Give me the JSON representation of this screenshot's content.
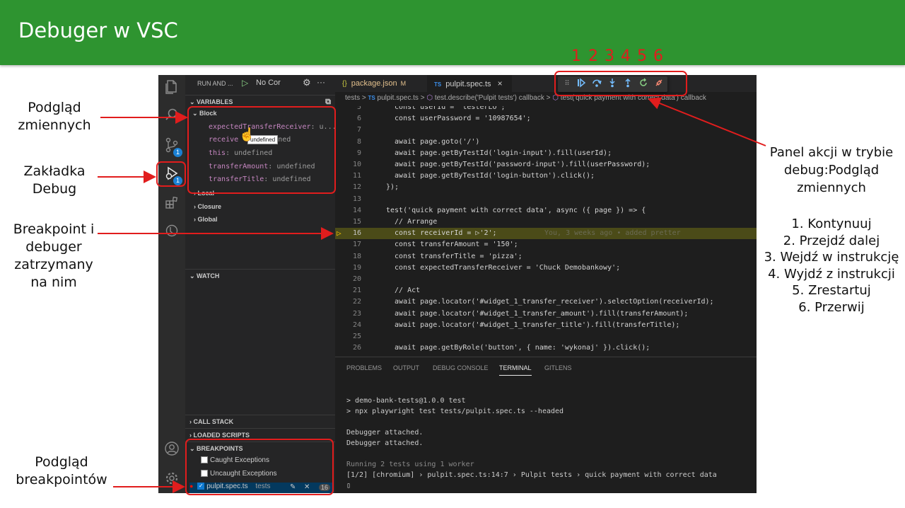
{
  "slide": {
    "title": "Debuger w VSC",
    "left_labels": {
      "variables_preview": [
        "Podgląd",
        "zmiennych"
      ],
      "debug_tab": [
        "Zakładka",
        "Debug"
      ],
      "breakpoint": [
        "Breakpoint i",
        "debuger",
        "zatrzymany",
        "na nim"
      ],
      "breakpoints_preview": [
        "Podgląd",
        "breakpointów"
      ]
    },
    "right_panel": {
      "heading": [
        "Panel akcji w trybie",
        "debug:Podgląd",
        "zmiennych"
      ],
      "actions": [
        "1. Kontynuuj",
        "2. Przejdź dalej",
        "3. Wejdź w instrukcję",
        "4. Wyjdź z instrukcji",
        "5. Zrestartuj",
        "6. Przerwij"
      ]
    },
    "toolbar_numbers": [
      "1",
      "2",
      "3",
      "4",
      "5",
      "6"
    ]
  },
  "colors": {
    "header_green": "#2e9430",
    "annotation_red": "#e11d1d",
    "vscode_bg": "#1e1e1e",
    "sidebar_bg": "#252526",
    "debug_blue": "#75beff",
    "continue_blue": "#75beff",
    "restart_green": "#89d185",
    "disconnect_red": "#f48771"
  },
  "vscode": {
    "activity_icons": [
      "files-icon",
      "search-icon",
      "source-control-icon",
      "run-debug-icon",
      "extensions-icon",
      "testing-icon",
      "account-icon",
      "settings-gear-icon"
    ],
    "badges": {
      "source_control": "1",
      "run_debug": "1"
    },
    "sidebar": {
      "run_label": "RUN AND ...",
      "config": "No Cor",
      "variables_header": "VARIABLES",
      "block_label": "Block",
      "variables": [
        {
          "name": "expectedTransferReceiver",
          "value": ": u..."
        },
        {
          "name": "receive",
          "value": "efined"
        },
        {
          "name": "this",
          "value": ": undefined"
        },
        {
          "name": "transferAmount",
          "value": ": undefined"
        },
        {
          "name": "transferTitle",
          "value": ": undefined"
        }
      ],
      "tooltip": "undefined",
      "scopes": [
        "Local",
        "Closure",
        "Global"
      ],
      "watch_header": "WATCH",
      "call_stack_header": "CALL STACK",
      "loaded_scripts_header": "LOADED SCRIPTS",
      "breakpoints_header": "BREAKPOINTS",
      "breakpoints": [
        {
          "label": "Caught Exceptions"
        },
        {
          "label": "Uncaught Exceptions"
        },
        {
          "label": "pulpit.spec.ts",
          "folder": "tests",
          "line": "16"
        }
      ]
    },
    "tabs": [
      {
        "icon": "{}",
        "label": "package.json",
        "status": "M"
      },
      {
        "icon": "TS",
        "label": "pulpit.spec.ts",
        "close": "×"
      }
    ],
    "breadcrumbs": {
      "folder": "tests",
      "sep": ">",
      "ts": "TS",
      "file": "pulpit.spec.ts",
      "describe": "test.describe('Pulpit tests') callback",
      "test": "test('quick payment with correct data') callback"
    },
    "code_lines": [
      {
        "n": "5",
        "t": "  const userId = 'testerLO';"
      },
      {
        "n": "6",
        "t": "  const userPassword = '10987654';"
      },
      {
        "n": "7",
        "t": ""
      },
      {
        "n": "8",
        "t": "  await page.goto('/')"
      },
      {
        "n": "9",
        "t": "  await page.getByTestId('login-input').fill(userId);"
      },
      {
        "n": "10",
        "t": "  await page.getByTestId('password-input').fill(userPassword);"
      },
      {
        "n": "11",
        "t": "  await page.getByTestId('login-button').click();"
      },
      {
        "n": "12",
        "t": "});"
      },
      {
        "n": "13",
        "t": ""
      },
      {
        "n": "14",
        "t": "test('quick payment with correct data', async ({ page }) => {"
      },
      {
        "n": "15",
        "t": "  // Arrange"
      },
      {
        "n": "16",
        "t": "  const receiverId = ▷'2';"
      },
      {
        "n": "17",
        "t": "  const transferAmount = '150';"
      },
      {
        "n": "18",
        "t": "  const transferTitle = 'pizza';"
      },
      {
        "n": "19",
        "t": "  const expectedTransferReceiver = 'Chuck Demobankowy';"
      },
      {
        "n": "20",
        "t": ""
      },
      {
        "n": "21",
        "t": "  // Act"
      },
      {
        "n": "22",
        "t": "  await page.locator('#widget_1_transfer_receiver').selectOption(receiverId);"
      },
      {
        "n": "23",
        "t": "  await page.locator('#widget_1_transfer_amount').fill(transferAmount);"
      },
      {
        "n": "24",
        "t": "  await page.locator('#widget_1_transfer_title').fill(transferTitle);"
      },
      {
        "n": "25",
        "t": ""
      },
      {
        "n": "26",
        "t": "  await page.getByRole('button', { name: 'wykonaj' }).click();"
      }
    ],
    "blame": "You, 3 weeks ago • added pretter",
    "panel_tabs": [
      "PROBLEMS",
      "OUTPUT",
      "DEBUG CONSOLE",
      "TERMINAL",
      "GITLENS"
    ],
    "terminal_lines": [
      "> demo-bank-tests@1.0.0 test",
      "> npx playwright test tests/pulpit.spec.ts --headed",
      "",
      "Debugger attached.",
      "Debugger attached.",
      "",
      "Running 2 tests using 1 worker",
      "[1/2] [chromium] › pulpit.spec.ts:14:7 › Pulpit tests › quick payment with correct data",
      "▯"
    ],
    "debug_toolbar": [
      "drag-grip-icon",
      "continue-icon",
      "step-over-icon",
      "step-into-icon",
      "step-out-icon",
      "restart-icon",
      "disconnect-icon"
    ]
  }
}
